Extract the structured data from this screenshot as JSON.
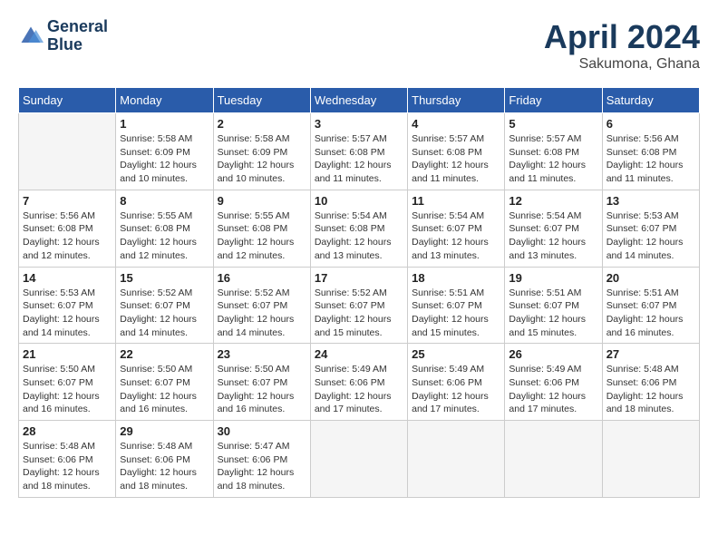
{
  "header": {
    "logo_line1": "General",
    "logo_line2": "Blue",
    "month_title": "April 2024",
    "location": "Sakumona, Ghana"
  },
  "calendar": {
    "days_of_week": [
      "Sunday",
      "Monday",
      "Tuesday",
      "Wednesday",
      "Thursday",
      "Friday",
      "Saturday"
    ],
    "weeks": [
      [
        {
          "day": "",
          "empty": true
        },
        {
          "day": "1",
          "sunrise": "Sunrise: 5:58 AM",
          "sunset": "Sunset: 6:09 PM",
          "daylight": "Daylight: 12 hours and 10 minutes."
        },
        {
          "day": "2",
          "sunrise": "Sunrise: 5:58 AM",
          "sunset": "Sunset: 6:09 PM",
          "daylight": "Daylight: 12 hours and 10 minutes."
        },
        {
          "day": "3",
          "sunrise": "Sunrise: 5:57 AM",
          "sunset": "Sunset: 6:08 PM",
          "daylight": "Daylight: 12 hours and 11 minutes."
        },
        {
          "day": "4",
          "sunrise": "Sunrise: 5:57 AM",
          "sunset": "Sunset: 6:08 PM",
          "daylight": "Daylight: 12 hours and 11 minutes."
        },
        {
          "day": "5",
          "sunrise": "Sunrise: 5:57 AM",
          "sunset": "Sunset: 6:08 PM",
          "daylight": "Daylight: 12 hours and 11 minutes."
        },
        {
          "day": "6",
          "sunrise": "Sunrise: 5:56 AM",
          "sunset": "Sunset: 6:08 PM",
          "daylight": "Daylight: 12 hours and 11 minutes."
        }
      ],
      [
        {
          "day": "7",
          "sunrise": "Sunrise: 5:56 AM",
          "sunset": "Sunset: 6:08 PM",
          "daylight": "Daylight: 12 hours and 12 minutes."
        },
        {
          "day": "8",
          "sunrise": "Sunrise: 5:55 AM",
          "sunset": "Sunset: 6:08 PM",
          "daylight": "Daylight: 12 hours and 12 minutes."
        },
        {
          "day": "9",
          "sunrise": "Sunrise: 5:55 AM",
          "sunset": "Sunset: 6:08 PM",
          "daylight": "Daylight: 12 hours and 12 minutes."
        },
        {
          "day": "10",
          "sunrise": "Sunrise: 5:54 AM",
          "sunset": "Sunset: 6:08 PM",
          "daylight": "Daylight: 12 hours and 13 minutes."
        },
        {
          "day": "11",
          "sunrise": "Sunrise: 5:54 AM",
          "sunset": "Sunset: 6:07 PM",
          "daylight": "Daylight: 12 hours and 13 minutes."
        },
        {
          "day": "12",
          "sunrise": "Sunrise: 5:54 AM",
          "sunset": "Sunset: 6:07 PM",
          "daylight": "Daylight: 12 hours and 13 minutes."
        },
        {
          "day": "13",
          "sunrise": "Sunrise: 5:53 AM",
          "sunset": "Sunset: 6:07 PM",
          "daylight": "Daylight: 12 hours and 14 minutes."
        }
      ],
      [
        {
          "day": "14",
          "sunrise": "Sunrise: 5:53 AM",
          "sunset": "Sunset: 6:07 PM",
          "daylight": "Daylight: 12 hours and 14 minutes."
        },
        {
          "day": "15",
          "sunrise": "Sunrise: 5:52 AM",
          "sunset": "Sunset: 6:07 PM",
          "daylight": "Daylight: 12 hours and 14 minutes."
        },
        {
          "day": "16",
          "sunrise": "Sunrise: 5:52 AM",
          "sunset": "Sunset: 6:07 PM",
          "daylight": "Daylight: 12 hours and 14 minutes."
        },
        {
          "day": "17",
          "sunrise": "Sunrise: 5:52 AM",
          "sunset": "Sunset: 6:07 PM",
          "daylight": "Daylight: 12 hours and 15 minutes."
        },
        {
          "day": "18",
          "sunrise": "Sunrise: 5:51 AM",
          "sunset": "Sunset: 6:07 PM",
          "daylight": "Daylight: 12 hours and 15 minutes."
        },
        {
          "day": "19",
          "sunrise": "Sunrise: 5:51 AM",
          "sunset": "Sunset: 6:07 PM",
          "daylight": "Daylight: 12 hours and 15 minutes."
        },
        {
          "day": "20",
          "sunrise": "Sunrise: 5:51 AM",
          "sunset": "Sunset: 6:07 PM",
          "daylight": "Daylight: 12 hours and 16 minutes."
        }
      ],
      [
        {
          "day": "21",
          "sunrise": "Sunrise: 5:50 AM",
          "sunset": "Sunset: 6:07 PM",
          "daylight": "Daylight: 12 hours and 16 minutes."
        },
        {
          "day": "22",
          "sunrise": "Sunrise: 5:50 AM",
          "sunset": "Sunset: 6:07 PM",
          "daylight": "Daylight: 12 hours and 16 minutes."
        },
        {
          "day": "23",
          "sunrise": "Sunrise: 5:50 AM",
          "sunset": "Sunset: 6:07 PM",
          "daylight": "Daylight: 12 hours and 16 minutes."
        },
        {
          "day": "24",
          "sunrise": "Sunrise: 5:49 AM",
          "sunset": "Sunset: 6:06 PM",
          "daylight": "Daylight: 12 hours and 17 minutes."
        },
        {
          "day": "25",
          "sunrise": "Sunrise: 5:49 AM",
          "sunset": "Sunset: 6:06 PM",
          "daylight": "Daylight: 12 hours and 17 minutes."
        },
        {
          "day": "26",
          "sunrise": "Sunrise: 5:49 AM",
          "sunset": "Sunset: 6:06 PM",
          "daylight": "Daylight: 12 hours and 17 minutes."
        },
        {
          "day": "27",
          "sunrise": "Sunrise: 5:48 AM",
          "sunset": "Sunset: 6:06 PM",
          "daylight": "Daylight: 12 hours and 18 minutes."
        }
      ],
      [
        {
          "day": "28",
          "sunrise": "Sunrise: 5:48 AM",
          "sunset": "Sunset: 6:06 PM",
          "daylight": "Daylight: 12 hours and 18 minutes."
        },
        {
          "day": "29",
          "sunrise": "Sunrise: 5:48 AM",
          "sunset": "Sunset: 6:06 PM",
          "daylight": "Daylight: 12 hours and 18 minutes."
        },
        {
          "day": "30",
          "sunrise": "Sunrise: 5:47 AM",
          "sunset": "Sunset: 6:06 PM",
          "daylight": "Daylight: 12 hours and 18 minutes."
        },
        {
          "day": "",
          "empty": true
        },
        {
          "day": "",
          "empty": true
        },
        {
          "day": "",
          "empty": true
        },
        {
          "day": "",
          "empty": true
        }
      ]
    ]
  }
}
